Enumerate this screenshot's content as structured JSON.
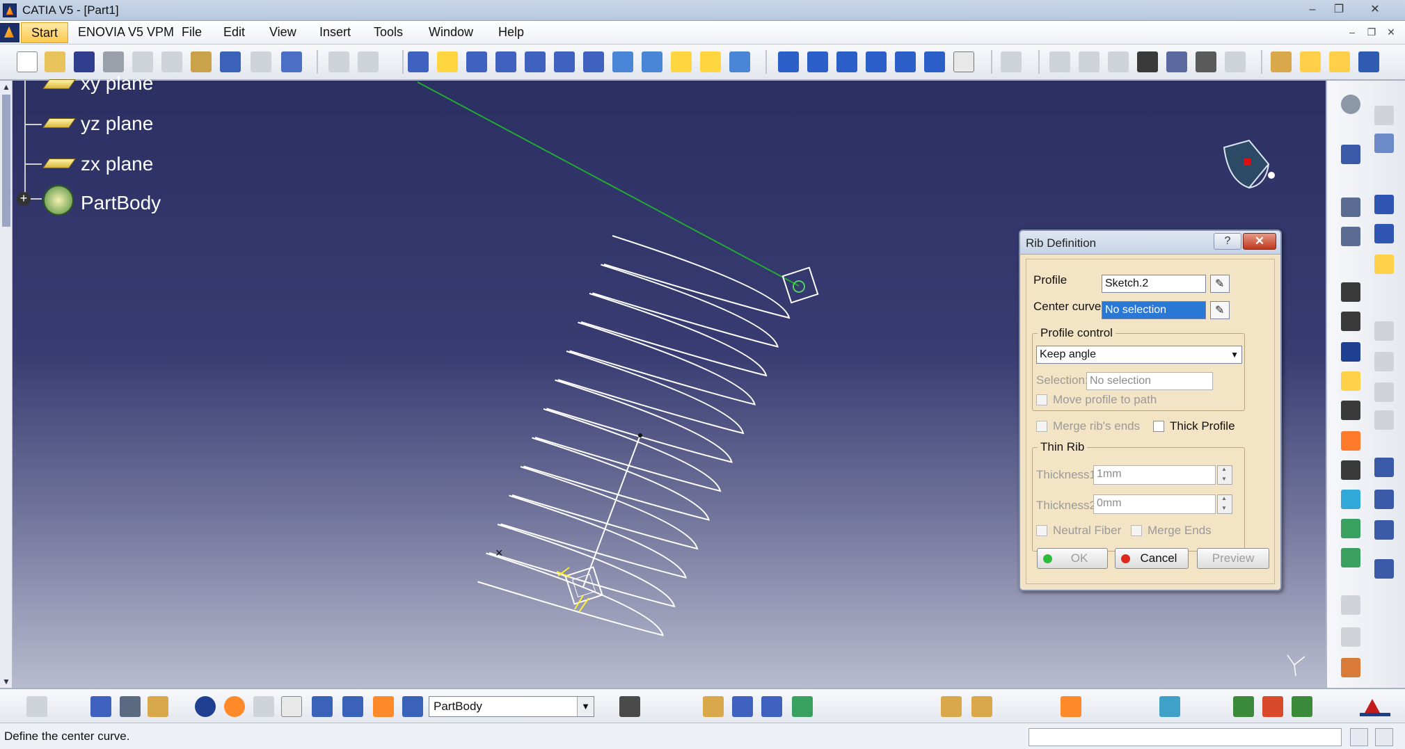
{
  "window": {
    "title": "CATIA V5 - [Part1]",
    "controls": {
      "minimize": "‒",
      "restore": "❐",
      "close": "✕"
    }
  },
  "menu": {
    "start": "Start",
    "items": [
      "ENOVIA V5 VPM",
      "File",
      "Edit",
      "View",
      "Insert",
      "Tools",
      "Window",
      "Help"
    ],
    "mdi_controls": {
      "minimize": "‒",
      "restore": "❐",
      "close": "✕"
    }
  },
  "tree": {
    "items": [
      {
        "label": "xy plane",
        "icon": "plane-icon"
      },
      {
        "label": "yz plane",
        "icon": "plane-icon"
      },
      {
        "label": "zx plane",
        "icon": "plane-icon"
      },
      {
        "label": "PartBody",
        "icon": "partbody-icon"
      }
    ]
  },
  "dialog": {
    "title": "Rib Definition",
    "help": "?",
    "close": "✕",
    "profile_label": "Profile",
    "profile_value": "Sketch.2",
    "center_curve_label": "Center curve",
    "center_curve_value": "No selection",
    "profile_control": {
      "title": "Profile control",
      "mode": "Keep angle",
      "selection_label": "Selection:",
      "selection_value": "No selection",
      "move_profile": "Move profile to path"
    },
    "merge_ribs_ends": "Merge rib's ends",
    "thick_profile": "Thick Profile",
    "thin_rib": {
      "title": "Thin Rib",
      "thickness1_label": "Thickness1:",
      "thickness1_value": "1mm",
      "thickness2_label": "Thickness2:",
      "thickness2_value": "0mm",
      "neutral_fiber": "Neutral Fiber",
      "merge_ends": "Merge Ends"
    },
    "buttons": {
      "ok": "OK",
      "cancel": "Cancel",
      "preview": "Preview"
    }
  },
  "bottom_toolbar": {
    "current_body": "PartBody"
  },
  "status": {
    "message": "Define the center curve."
  },
  "colors": {
    "viewport_top": "#2c2f62",
    "viewport_bottom": "#b9bbcf",
    "dialog_bg": "#f1e3c8",
    "selection": "#2a78d6",
    "helix": "#ffffff",
    "guide_line": "#22aa33"
  }
}
